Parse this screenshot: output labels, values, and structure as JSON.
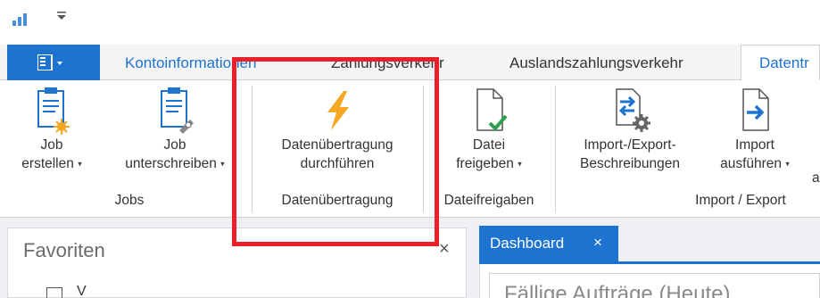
{
  "quick_access": {
    "chart_icon": "bar-chart-icon",
    "dropdown_icon": "customize-dropdown-icon"
  },
  "tabs": {
    "file_icon": "application-menu-icon",
    "items": [
      {
        "label": "Kontoinformationen"
      },
      {
        "label": "Zahlungsverkehr"
      },
      {
        "label": "Auslandszahlungsverkehr"
      },
      {
        "label": "Datentr"
      }
    ]
  },
  "ribbon": {
    "job_create": {
      "line1": "Job",
      "line2": "erstellen",
      "caret": "▾",
      "icon": "clipboard-new-icon"
    },
    "job_sign": {
      "line1": "Job",
      "line2": "unterschreiben",
      "caret": "▾",
      "icon": "clipboard-sign-icon"
    },
    "transfer": {
      "line1": "Datenübertragung",
      "line2": "durchführen",
      "icon": "lightning-icon"
    },
    "release": {
      "line1": "Datei",
      "line2": "freigeben",
      "caret": "▾",
      "icon": "file-check-icon"
    },
    "import_desc": {
      "line1": "Import-/Export-",
      "line2": "Beschreibungen",
      "icon": "import-export-settings-icon"
    },
    "import_run": {
      "line1": "Import",
      "line2": "ausführen",
      "caret": "▾",
      "icon": "file-import-icon"
    },
    "cut_off": {
      "line2": "a"
    },
    "groups": {
      "jobs": "Jobs",
      "transfer": "Datenübertragung",
      "release": "Dateifreigaben",
      "import_export": "Import / Export"
    }
  },
  "favorites": {
    "title": "Favoriten",
    "close": "×",
    "item_partial": "V"
  },
  "dashboard": {
    "tab_label": "Dashboard",
    "tab_close": "×",
    "widget_title": "Fällige Aufträge (Heute)"
  },
  "colors": {
    "accent": "#1e73d0",
    "highlight": "#e8202a",
    "lightning": "#f5a623"
  }
}
